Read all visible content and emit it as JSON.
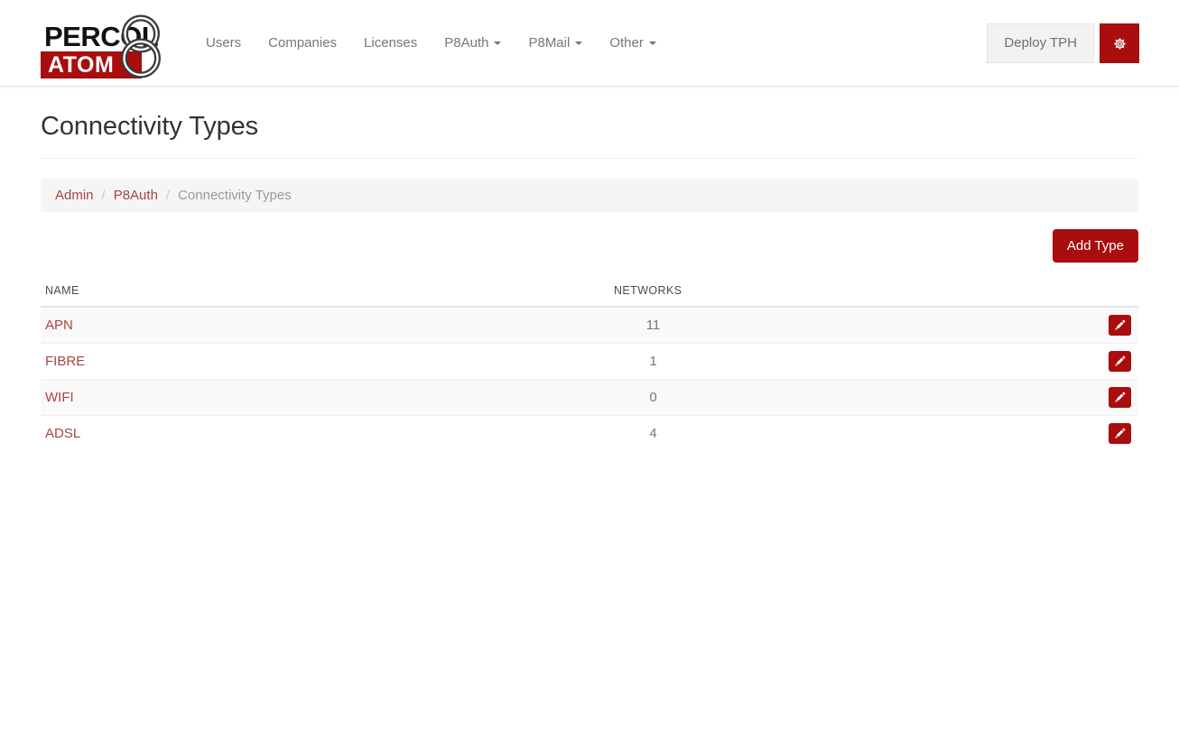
{
  "navbar": {
    "brand": {
      "line1": "PERCOL",
      "line2": "ATOM",
      "glyph": "8"
    },
    "links": [
      {
        "label": "Users",
        "caret": false
      },
      {
        "label": "Companies",
        "caret": false
      },
      {
        "label": "Licenses",
        "caret": false
      },
      {
        "label": "P8Auth",
        "caret": true
      },
      {
        "label": "P8Mail",
        "caret": true
      },
      {
        "label": "Other",
        "caret": true
      }
    ],
    "deploy_label": "Deploy TPH",
    "settings_icon": "gear-icon"
  },
  "page": {
    "title": "Connectivity Types"
  },
  "breadcrumb": {
    "items": [
      {
        "label": "Admin",
        "active": false
      },
      {
        "label": "P8Auth",
        "active": false
      },
      {
        "label": "Connectivity Types",
        "active": true
      }
    ],
    "separator": "/"
  },
  "actions": {
    "add_label": "Add Type"
  },
  "table": {
    "columns": {
      "name": "NAME",
      "networks": "NETWORKS"
    },
    "rows": [
      {
        "name": "APN",
        "networks": "11",
        "edit_icon": "pencil-icon"
      },
      {
        "name": "FIBRE",
        "networks": "1",
        "edit_icon": "pencil-icon"
      },
      {
        "name": "WIFI",
        "networks": "0",
        "edit_icon": "pencil-icon"
      },
      {
        "name": "ADSL",
        "networks": "4",
        "edit_icon": "pencil-icon"
      }
    ]
  },
  "colors": {
    "brand_red": "#a90d0d",
    "link_red": "#a94442",
    "muted_text": "#777777",
    "stripe": "#f9f9f9",
    "breadcrumb_bg": "#f5f5f5"
  }
}
